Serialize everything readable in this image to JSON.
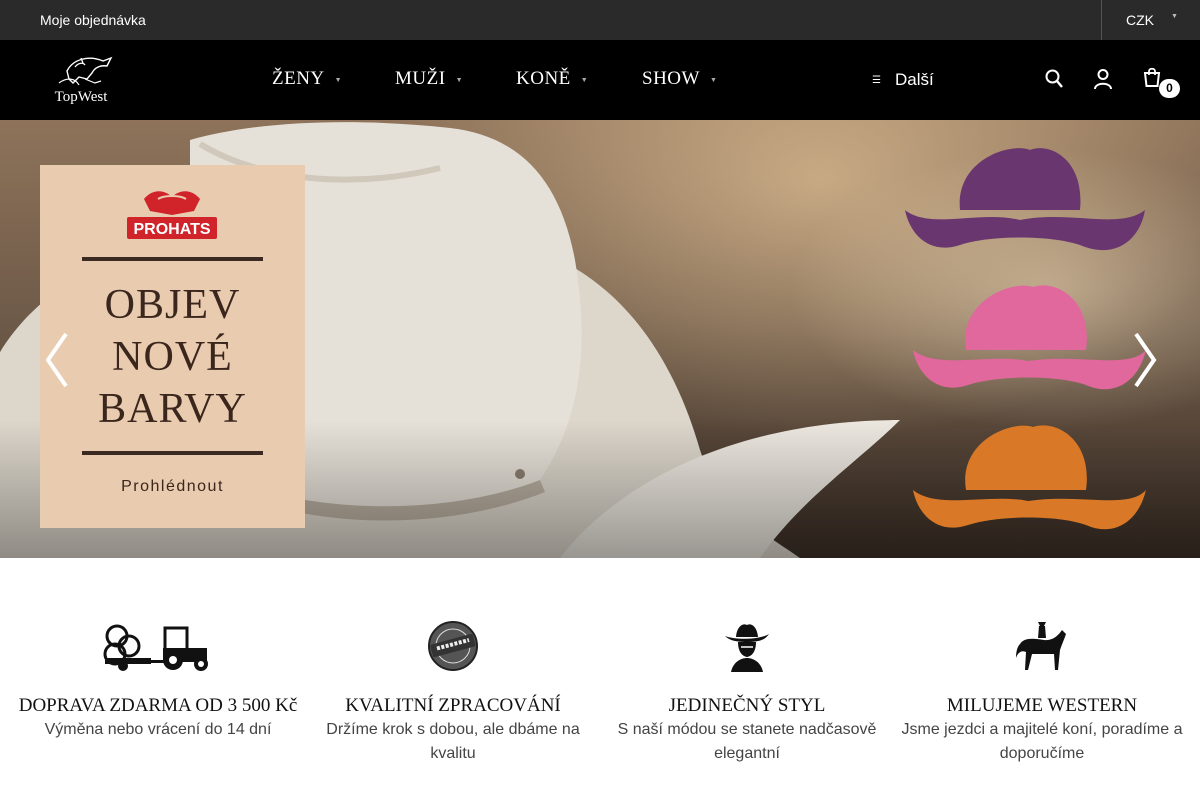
{
  "topbar": {
    "order_link": "Moje objednávka",
    "currency": "CZK"
  },
  "header": {
    "logo_text": "TopWest",
    "nav": [
      {
        "label": "ŽENY"
      },
      {
        "label": "MUŽI"
      },
      {
        "label": "KONĚ"
      },
      {
        "label": "SHOW"
      }
    ],
    "more_label": "Další",
    "cart_count": "0",
    "icons": [
      "search-icon",
      "user-icon",
      "cart-icon"
    ]
  },
  "hero": {
    "brand": "PROHATS",
    "headline": [
      "OBJEV",
      "NOVÉ",
      "BARVY"
    ],
    "cta": "Prohlédnout",
    "hat_colors": [
      "#6a3670",
      "#e0689c",
      "#d97826"
    ]
  },
  "features": [
    {
      "icon": "tractor-icon",
      "title": "DOPRAVA ZDARMA OD 3 500 Kč",
      "desc": "Výměna nebo vrácení do 14 dní"
    },
    {
      "icon": "quality-badge-icon",
      "title": "KVALITNÍ ZPRACOVÁNÍ",
      "desc": "Držíme krok s dobou, ale dbáme na kvalitu"
    },
    {
      "icon": "cowboy-icon",
      "title": "JEDINEČNÝ STYL",
      "desc": "S naší módou se stanete nadčasově elegantní"
    },
    {
      "icon": "horse-rider-icon",
      "title": "MILUJEME WESTERN",
      "desc": "Jsme jezdci a majitelé koní, poradíme a doporučíme"
    }
  ]
}
